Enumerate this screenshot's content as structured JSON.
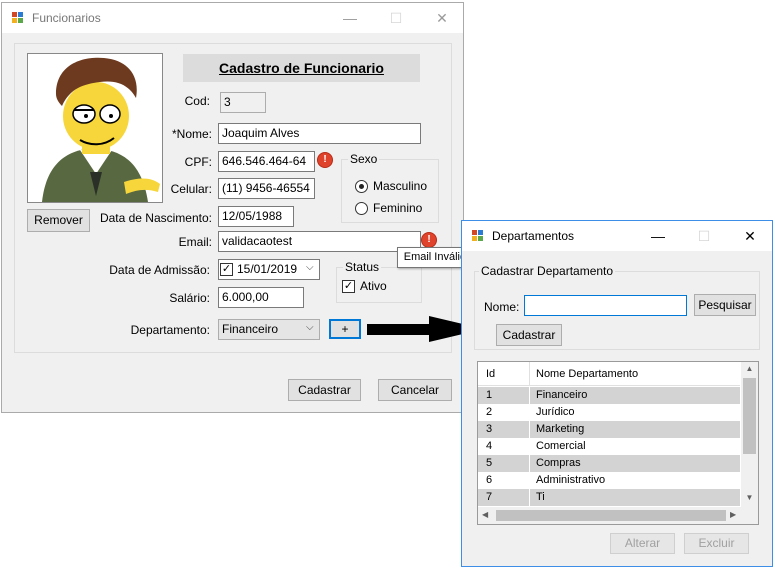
{
  "funcionarios": {
    "title": "Funcionarios",
    "header": "Cadastro de Funcionario",
    "remover_label": "Remover",
    "fields": {
      "cod_label": "Cod:",
      "cod_value": "3",
      "nome_label": "*Nome:",
      "nome_value": "Joaquim Alves",
      "cpf_label": "CPF:",
      "cpf_value": "646.546.464-64",
      "celular_label": "Celular:",
      "celular_value": "(11) 9456-46554",
      "nascimento_label": "Data de Nascimento:",
      "nascimento_value": "12/05/1988",
      "email_label": "Email:",
      "email_value": "validacaotest",
      "admissao_label": "Data de Admissão:",
      "admissao_value": "15/01/2019",
      "salario_label": "Salário:",
      "salario_value": "6.000,00",
      "departamento_label": "Departamento:",
      "departamento_value": "Financeiro"
    },
    "sexo": {
      "title": "Sexo",
      "masculino": "Masculino",
      "feminino": "Feminino",
      "selected": "Masculino"
    },
    "status": {
      "title": "Status",
      "ativo": "Ativo",
      "checked": true
    },
    "error_glyph": "!",
    "email_tooltip": "Email Inválido",
    "add_button": "+",
    "cadastrar_label": "Cadastrar",
    "cancelar_label": "Cancelar"
  },
  "departamentos": {
    "title": "Departamentos",
    "group_title": "Cadastrar Departamento",
    "nome_label": "Nome:",
    "nome_value": "",
    "pesquisar_label": "Pesquisar",
    "cadastrar_label": "Cadastrar",
    "columns": [
      "Id",
      "Nome Departamento"
    ],
    "rows": [
      {
        "id": "1",
        "nome": "Financeiro"
      },
      {
        "id": "2",
        "nome": "Jurídico"
      },
      {
        "id": "3",
        "nome": "Marketing"
      },
      {
        "id": "4",
        "nome": "Comercial"
      },
      {
        "id": "5",
        "nome": "Compras"
      },
      {
        "id": "6",
        "nome": "Administrativo"
      },
      {
        "id": "7",
        "nome": "Ti"
      }
    ],
    "alterar_label": "Alterar",
    "excluir_label": "Excluir"
  },
  "window_controls": {
    "minimize": "—",
    "maximize": "☐",
    "close": "✕"
  },
  "scroll_glyphs": {
    "up": "▲",
    "down": "▼",
    "left": "◀",
    "right": "▶"
  },
  "colors": {
    "accent": "#0078d7",
    "error": "#e0432b",
    "grid_alt_row": "#d3d3d3"
  }
}
